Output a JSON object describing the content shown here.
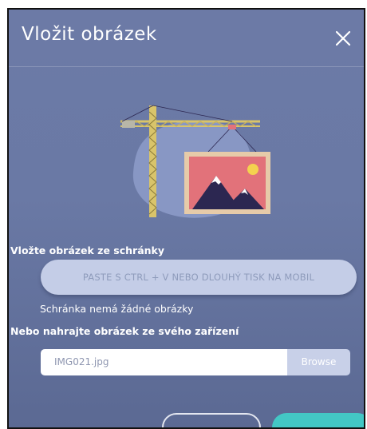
{
  "dialog": {
    "title": "Vložit obrázek",
    "close_icon": "close-icon"
  },
  "illustration": {
    "icon": "crane-with-picture-illustration",
    "colors": {
      "blob": "#8897c4",
      "crane": "#d9c46a",
      "frame": "#e6cba9",
      "picture_bg": "#e2727a",
      "mountain": "#2c2751",
      "snow": "#ffffff",
      "sun": "#f4d24f"
    }
  },
  "clipboard": {
    "label": "Vložte obrázek ze schránky",
    "paste_placeholder": "PASTE S CTRL + V NEBO DLOUHÝ TISK NA MOBIL",
    "empty_message": "Schránka nemá žádné obrázky"
  },
  "upload": {
    "label": "Nebo nahrajte obrázek ze svého zařízení",
    "file_name": "IMG021.jpg",
    "browse_label": "Browse"
  },
  "colors": {
    "dialog_bg": "#6a79a5",
    "accent": "#43c7c5",
    "field_bg": "#c4cde7"
  }
}
